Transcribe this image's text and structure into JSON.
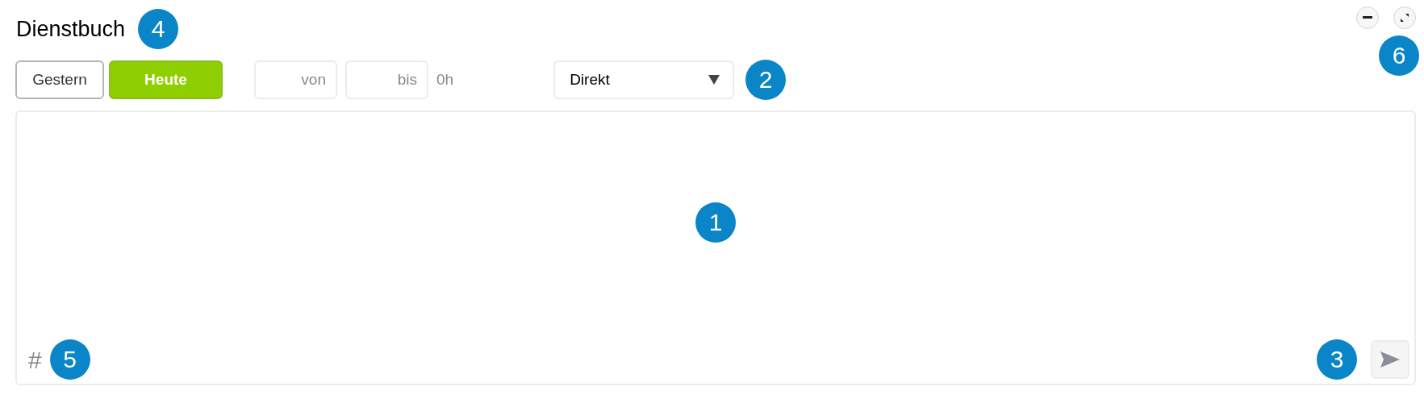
{
  "header": {
    "title": "Dienstbuch",
    "marker": "4"
  },
  "window_controls": {
    "marker": "6"
  },
  "day_tabs": [
    {
      "label": "Gestern",
      "selected": false
    },
    {
      "label": "Heute",
      "selected": true
    }
  ],
  "time_range": {
    "from": {
      "placeholder": "von"
    },
    "to": {
      "placeholder": "bis"
    },
    "duration": "0h"
  },
  "channel_select": {
    "value": "Direkt",
    "marker": "2"
  },
  "composer": {
    "marker": "1",
    "hashtag": "#",
    "hashtag_marker": "5",
    "send": {
      "disabled": true,
      "marker": "3"
    }
  }
}
